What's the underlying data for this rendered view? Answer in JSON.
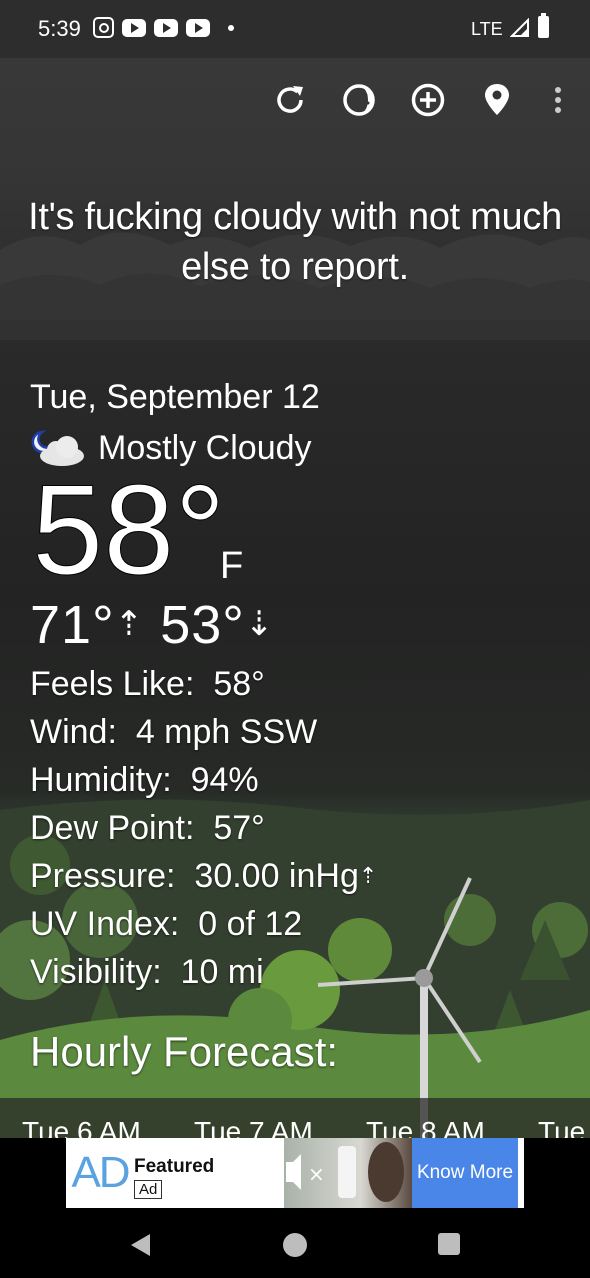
{
  "status_bar": {
    "time": "5:39",
    "network": "LTE"
  },
  "toolbar": {
    "icons": [
      "refresh-icon",
      "theme-icon",
      "add-location-icon",
      "location-pin-icon",
      "more-options-icon"
    ]
  },
  "headline": "It's fucking cloudy with not much else to report.",
  "current": {
    "date": "Tue, September 12",
    "condition": "Mostly Cloudy",
    "temperature": "58°",
    "unit": "F",
    "high": "71°",
    "low": "53°"
  },
  "details": {
    "feels_like_label": "Feels Like:",
    "feels_like": "58°",
    "wind_label": "Wind:",
    "wind": "4 mph SSW",
    "humidity_label": "Humidity:",
    "humidity": "94%",
    "dew_point_label": "Dew Point:",
    "dew_point": "57°",
    "pressure_label": "Pressure:",
    "pressure": "30.00 inHg",
    "uv_label": "UV Index:",
    "uv": "0 of 12",
    "visibility_label": "Visibility:",
    "visibility": "10 mi"
  },
  "hourly": {
    "title": "Hourly Forecast:",
    "hours": [
      "Tue 6 AM",
      "Tue 7 AM",
      "Tue 8 AM",
      "Tue"
    ]
  },
  "ad": {
    "logo": "AD",
    "featured": "Featured",
    "badge": "Ad",
    "cta": "Know More",
    "colors": {
      "cta": "#4a86e8",
      "logo": "#5aa2e0"
    }
  }
}
